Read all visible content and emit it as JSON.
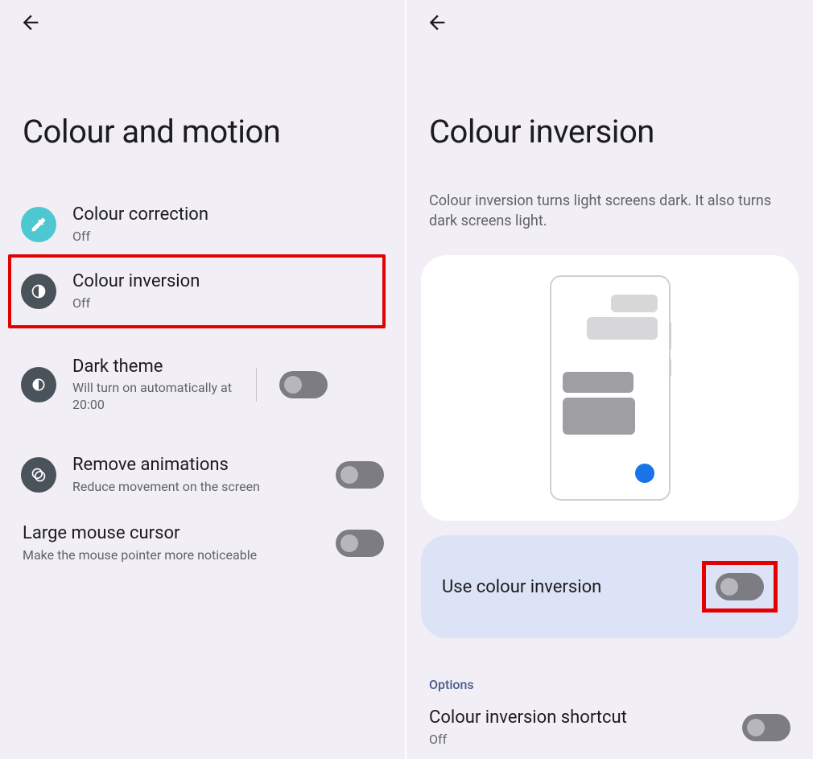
{
  "left": {
    "title": "Colour and motion",
    "items": {
      "colour_correction": {
        "label": "Colour correction",
        "status": "Off"
      },
      "colour_inversion": {
        "label": "Colour inversion",
        "status": "Off"
      },
      "dark_theme": {
        "label": "Dark theme",
        "status": "Will turn on automatically at 20:00"
      },
      "remove_animations": {
        "label": "Remove animations",
        "status": "Reduce movement on the screen"
      },
      "large_cursor": {
        "label": "Large mouse cursor",
        "status": "Make the mouse pointer more noticeable"
      }
    }
  },
  "right": {
    "title": "Colour inversion",
    "description": "Colour inversion turns light screens dark. It also turns dark screens light.",
    "use_label": "Use colour inversion",
    "options_header": "Options",
    "shortcut": {
      "label": "Colour inversion shortcut",
      "status": "Off"
    }
  }
}
